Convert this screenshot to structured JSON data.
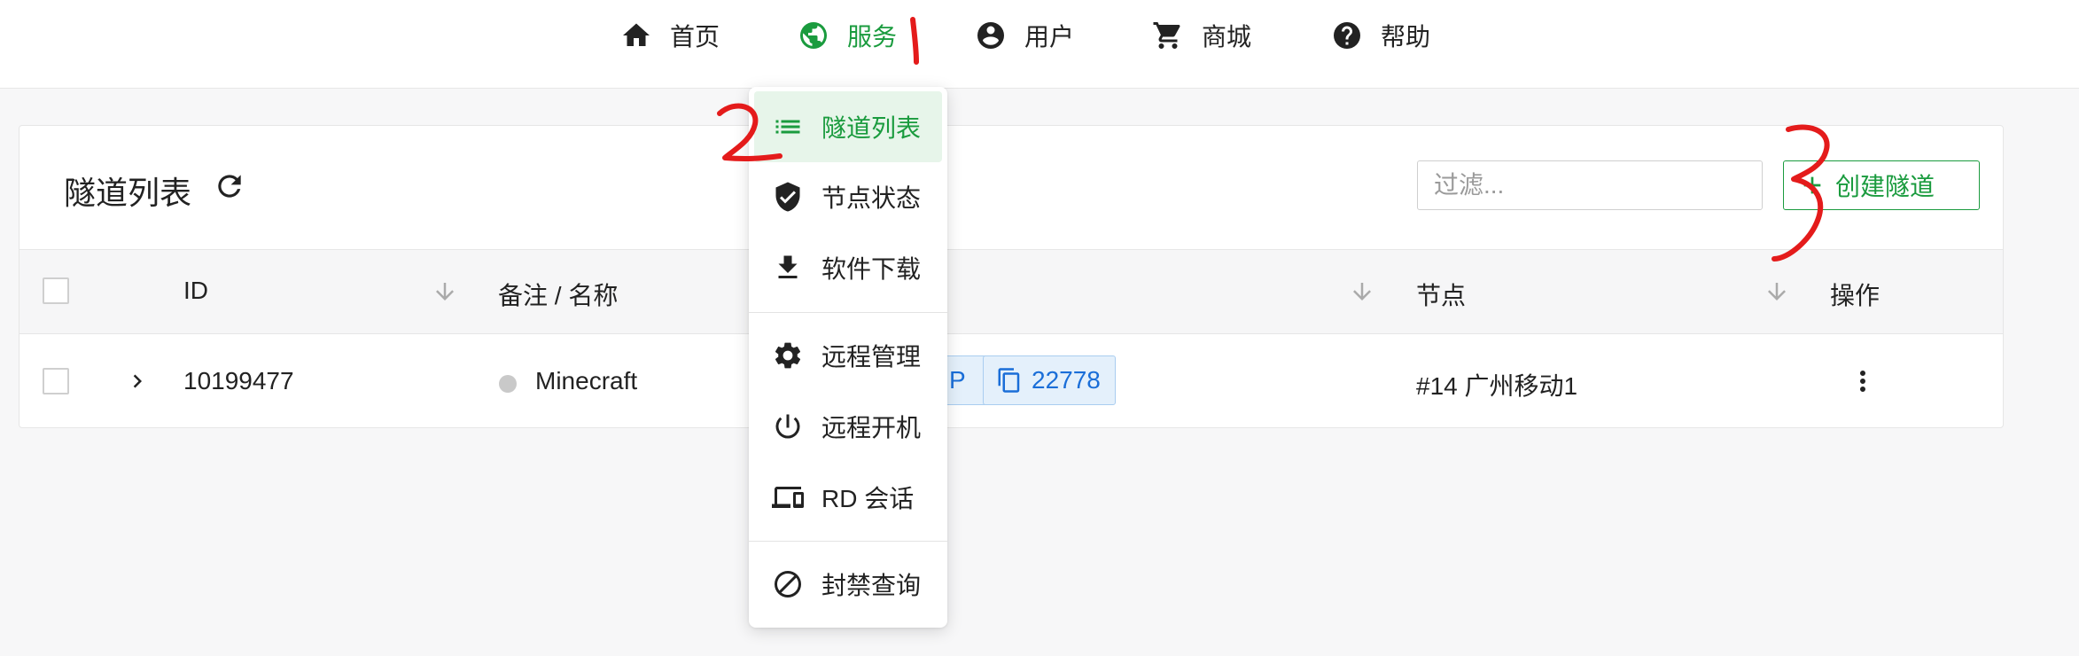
{
  "nav": {
    "items": [
      {
        "label": "首页",
        "icon": "home-icon"
      },
      {
        "label": "服务",
        "icon": "globe-icon",
        "active": true
      },
      {
        "label": "用户",
        "icon": "account-circle-icon"
      },
      {
        "label": "商城",
        "icon": "cart-icon"
      },
      {
        "label": "帮助",
        "icon": "help-circle-icon"
      }
    ],
    "active_color": "#1a9b3e"
  },
  "services_menu": {
    "items": [
      {
        "label": "隧道列表",
        "icon": "list-icon",
        "active": true
      },
      {
        "label": "节点状态",
        "icon": "shield-check-icon"
      },
      {
        "label": "软件下载",
        "icon": "download-icon"
      },
      {
        "label": "远程管理",
        "icon": "gear-icon"
      },
      {
        "label": "远程开机",
        "icon": "power-icon"
      },
      {
        "label": "RD 会话",
        "icon": "devices-icon"
      },
      {
        "label": "封禁查询",
        "icon": "block-icon"
      }
    ]
  },
  "card": {
    "title": "隧道列表",
    "filter_placeholder": "过滤...",
    "create_button": "创建隧道"
  },
  "table": {
    "columns": [
      "ID",
      "备注 / 名称",
      "节点",
      "操作"
    ],
    "rows": [
      {
        "id": "10199477",
        "name": "Minecraft",
        "status_color": "#c9c9c9",
        "partial_chip": "P",
        "port": "22778",
        "node": "#14 广州移动1"
      }
    ]
  },
  "annotations": [
    "1",
    "2",
    "3"
  ],
  "colors": {
    "accent_green": "#1a9b3e",
    "chip_blue": "#1a6ed8",
    "annotation_red": "#e41b1b"
  }
}
